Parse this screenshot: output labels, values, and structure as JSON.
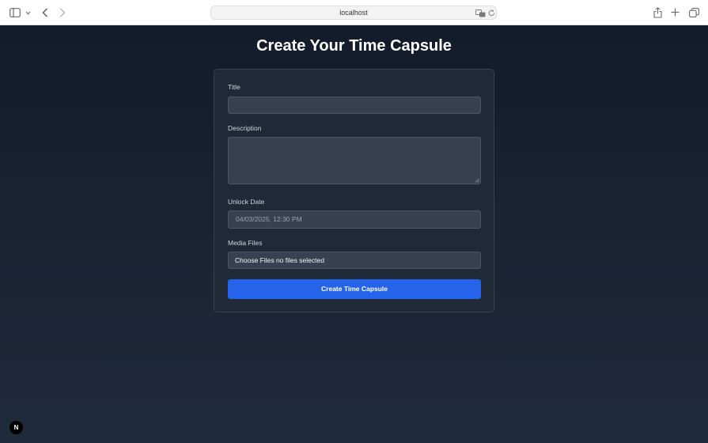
{
  "browser": {
    "url": "localhost",
    "icons": {
      "sidebar": "sidebar-icon",
      "back": "chevron-left-icon",
      "forward": "chevron-right-icon",
      "translate": "translate-icon",
      "reload": "reload-icon",
      "share": "share-icon",
      "new_tab": "plus-icon",
      "tabs": "tabs-overview-icon"
    }
  },
  "page": {
    "title": "Create Your Time Capsule"
  },
  "form": {
    "title_label": "Title",
    "title_value": "",
    "description_label": "Description",
    "description_value": "",
    "unlock_date_label": "Unlock Date",
    "unlock_date_value": "04/03/2025, 12:30 PM",
    "media_label": "Media Files",
    "media_value": "Choose Files no files selected",
    "submit_label": "Create Time Capsule"
  },
  "dev_badge": {
    "label": "N"
  },
  "colors": {
    "background": "#1a2233",
    "card": "#1f2937",
    "input": "#374151",
    "accent": "#2563eb"
  }
}
